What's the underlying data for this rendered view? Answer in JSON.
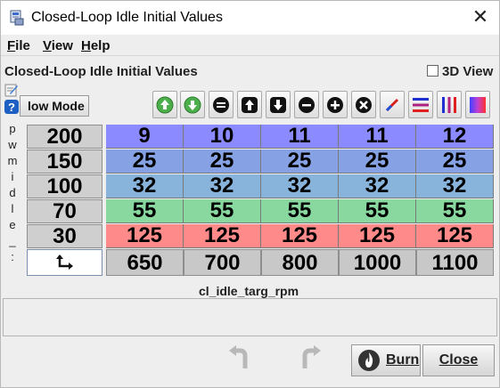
{
  "window": {
    "title": "Closed-Loop Idle Initial Values",
    "close_glyph": "✕"
  },
  "menubar": {
    "items": [
      {
        "label": "File",
        "mnemonic": "F"
      },
      {
        "label": "View",
        "mnemonic": "V"
      },
      {
        "label": "Help",
        "mnemonic": "H"
      }
    ]
  },
  "panel": {
    "title": "Closed-Loop Idle Initial Values",
    "view3d_label": "3D View",
    "view3d_checked": false,
    "mode_button_label": "low Mode",
    "side_axis_label": [
      "p",
      "w",
      "m",
      "i",
      "d",
      "l",
      "e",
      "_",
      ":"
    ]
  },
  "toolbar": {
    "icons": [
      "increase-icon",
      "decrease-icon",
      "equals-icon",
      "shift-up-icon",
      "shift-down-icon",
      "subtract-icon",
      "add-icon",
      "multiply-icon",
      "interpolate-icon",
      "horizontal-interpolate-icon",
      "vertical-interpolate-icon",
      "color-gradient-icon"
    ]
  },
  "table": {
    "y_axis": [
      "200",
      "150",
      "100",
      "70",
      "30"
    ],
    "x_axis": [
      "650",
      "700",
      "800",
      "1000",
      "1100"
    ],
    "rows": [
      [
        "9",
        "10",
        "11",
        "11",
        "12"
      ],
      [
        "25",
        "25",
        "25",
        "25",
        "25"
      ],
      [
        "32",
        "32",
        "32",
        "32",
        "32"
      ],
      [
        "55",
        "55",
        "55",
        "55",
        "55"
      ],
      [
        "125",
        "125",
        "125",
        "125",
        "125"
      ]
    ],
    "row_colors": [
      "#8b8bff",
      "#86a2e4",
      "#88b4dc",
      "#88d8a0",
      "#ff8a8a"
    ],
    "x_label": "cl_idle_targ_rpm"
  },
  "footer": {
    "burn_label": "Burn",
    "close_label": "Close"
  }
}
